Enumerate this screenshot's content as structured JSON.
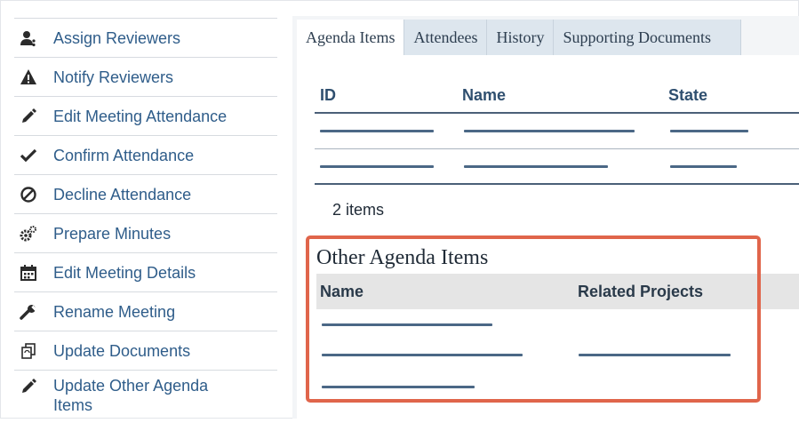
{
  "sidebar": {
    "items": [
      {
        "label": "Assign Reviewers",
        "icon": "assign-reviewers-icon"
      },
      {
        "label": "Notify Reviewers",
        "icon": "warning-icon"
      },
      {
        "label": "Edit Meeting Attendance",
        "icon": "pencil-icon"
      },
      {
        "label": "Confirm Attendance",
        "icon": "checkmark-icon"
      },
      {
        "label": "Decline Attendance",
        "icon": "prohibited-icon"
      },
      {
        "label": "Prepare Minutes",
        "icon": "gears-icon"
      },
      {
        "label": "Edit Meeting Details",
        "icon": "calendar-icon"
      },
      {
        "label": "Rename Meeting",
        "icon": "wrench-icon"
      },
      {
        "label": "Update Documents",
        "icon": "documents-icon"
      },
      {
        "label": "Update Other Agenda Items",
        "icon": "pencil-icon"
      }
    ]
  },
  "tabs": [
    "Agenda Items",
    "Attendees",
    "History",
    "Supporting Documents"
  ],
  "active_tab": "Agenda Items",
  "agenda_table": {
    "columns": [
      "ID",
      "Name",
      "State"
    ],
    "count_text": "2 items"
  },
  "other_agenda": {
    "title": "Other Agenda Items",
    "columns": [
      "Name",
      "Related Projects"
    ]
  },
  "colors": {
    "link": "#2f5d8a",
    "highlight": "#e0654b",
    "tab_inactive": "#dde6ee"
  }
}
